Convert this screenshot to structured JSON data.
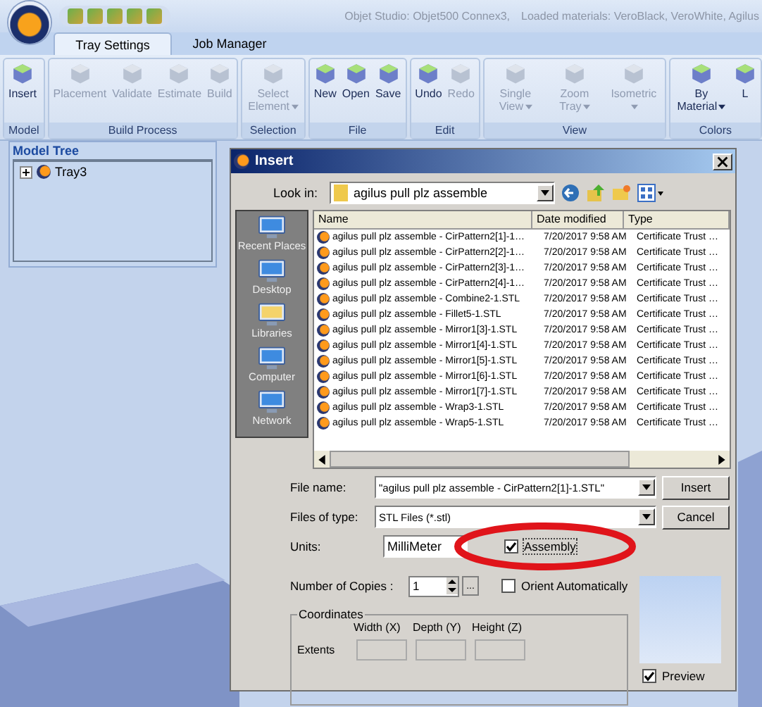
{
  "title_bar": {
    "title": "Objet Studio: Objet500 Connex3,",
    "materials": "Loaded materials: VeroBlack, VeroWhite, Agilus"
  },
  "tabs": [
    {
      "label": "Tray Settings",
      "selected": true
    },
    {
      "label": "Job Manager",
      "selected": false
    }
  ],
  "ribbon": [
    {
      "label": "Model",
      "buttons": [
        {
          "label": "Insert",
          "disabled": false,
          "dropdown": false
        }
      ]
    },
    {
      "label": "Build Process",
      "buttons": [
        {
          "label": "Placement",
          "disabled": true,
          "dropdown": false
        },
        {
          "label": "Validate",
          "disabled": true,
          "dropdown": false
        },
        {
          "label": "Estimate",
          "disabled": true,
          "dropdown": false
        },
        {
          "label": "Build",
          "disabled": true,
          "dropdown": false
        }
      ]
    },
    {
      "label": "Selection",
      "buttons": [
        {
          "label": "Select Element",
          "disabled": true,
          "dropdown": true
        }
      ]
    },
    {
      "label": "File",
      "buttons": [
        {
          "label": "New",
          "disabled": false,
          "dropdown": false
        },
        {
          "label": "Open",
          "disabled": false,
          "dropdown": false
        },
        {
          "label": "Save",
          "disabled": false,
          "dropdown": false
        }
      ]
    },
    {
      "label": "Edit",
      "buttons": [
        {
          "label": "Undo",
          "disabled": false,
          "dropdown": false
        },
        {
          "label": "Redo",
          "disabled": true,
          "dropdown": false
        }
      ]
    },
    {
      "label": "View",
      "buttons": [
        {
          "label": "Single View",
          "disabled": true,
          "dropdown": true
        },
        {
          "label": "Zoom Tray",
          "disabled": true,
          "dropdown": true
        },
        {
          "label": "Isometric",
          "disabled": true,
          "dropdown": true
        }
      ]
    },
    {
      "label": "Colors",
      "buttons": [
        {
          "label": "By Material",
          "disabled": false,
          "dropdown": true
        },
        {
          "label": "L",
          "disabled": false,
          "dropdown": false
        }
      ]
    }
  ],
  "model_tree": {
    "title": "Model Tree",
    "items": [
      {
        "label": "Tray3",
        "expanded": false
      }
    ]
  },
  "dialog": {
    "title": "Insert",
    "look_in_label": "Look in:",
    "look_in": "agilus pull plz assemble",
    "places": [
      "Recent Places",
      "Desktop",
      "Libraries",
      "Computer",
      "Network"
    ],
    "columns": [
      "Name",
      "Date modified",
      "Type"
    ],
    "files": [
      {
        "name": "agilus pull plz assemble - CirPattern2[1]-1…",
        "date": "7/20/2017 9:58 AM",
        "type": "Certificate Trust …"
      },
      {
        "name": "agilus pull plz assemble - CirPattern2[2]-1…",
        "date": "7/20/2017 9:58 AM",
        "type": "Certificate Trust …"
      },
      {
        "name": "agilus pull plz assemble - CirPattern2[3]-1…",
        "date": "7/20/2017 9:58 AM",
        "type": "Certificate Trust …"
      },
      {
        "name": "agilus pull plz assemble - CirPattern2[4]-1…",
        "date": "7/20/2017 9:58 AM",
        "type": "Certificate Trust …"
      },
      {
        "name": "agilus pull plz assemble - Combine2-1.STL",
        "date": "7/20/2017 9:58 AM",
        "type": "Certificate Trust …"
      },
      {
        "name": "agilus pull plz assemble - Fillet5-1.STL",
        "date": "7/20/2017 9:58 AM",
        "type": "Certificate Trust …"
      },
      {
        "name": "agilus pull plz assemble - Mirror1[3]-1.STL",
        "date": "7/20/2017 9:58 AM",
        "type": "Certificate Trust …"
      },
      {
        "name": "agilus pull plz assemble - Mirror1[4]-1.STL",
        "date": "7/20/2017 9:58 AM",
        "type": "Certificate Trust …"
      },
      {
        "name": "agilus pull plz assemble - Mirror1[5]-1.STL",
        "date": "7/20/2017 9:58 AM",
        "type": "Certificate Trust …"
      },
      {
        "name": "agilus pull plz assemble - Mirror1[6]-1.STL",
        "date": "7/20/2017 9:58 AM",
        "type": "Certificate Trust …"
      },
      {
        "name": "agilus pull plz assemble - Mirror1[7]-1.STL",
        "date": "7/20/2017 9:58 AM",
        "type": "Certificate Trust …"
      },
      {
        "name": "agilus pull plz assemble - Wrap3-1.STL",
        "date": "7/20/2017 9:58 AM",
        "type": "Certificate Trust …"
      },
      {
        "name": "agilus pull plz assemble - Wrap5-1.STL",
        "date": "7/20/2017 9:58 AM",
        "type": "Certificate Trust …"
      }
    ],
    "file_name_label": "File name:",
    "file_name": "\"agilus pull plz assemble - CirPattern2[1]-1.STL\"",
    "file_type_label": "Files of type:",
    "file_type": "STL Files (*.stl)",
    "insert_button": "Insert",
    "cancel_button": "Cancel",
    "units_label": "Units:",
    "units": "MilliMeter",
    "copies_label": "Number of Copies :",
    "copies": "1",
    "copies_more": "...",
    "assembly": {
      "label": "Assembly",
      "checked": true
    },
    "orient": {
      "label": "Orient Automatically",
      "checked": false
    },
    "coordinates": {
      "title": "Coordinates",
      "headers": [
        "Width (X)",
        "Depth (Y)",
        "Height (Z)"
      ],
      "extents_label": "Extents"
    },
    "preview": {
      "label": "Preview",
      "checked": true
    }
  }
}
